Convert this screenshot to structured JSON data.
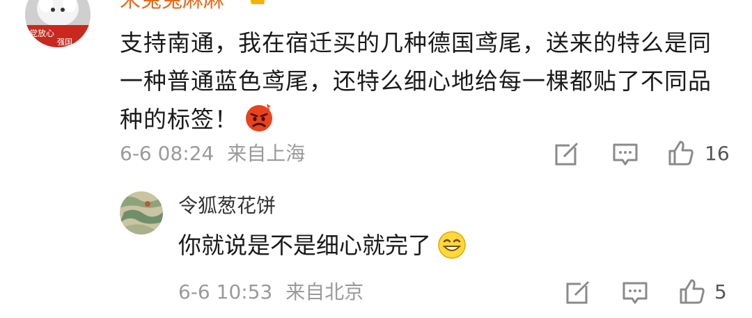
{
  "comment": {
    "username": "宋兔兔麻麻",
    "avatar_caption_1": "党放心",
    "avatar_caption_2": "强国",
    "text": "支持南通，我在宿迁买的几种德国鸢尾，送来的特么是同一种普通蓝色鸢尾，还特么细心地给每一棵都贴了不同品种的标签！",
    "emoji": "angry-face-emoji",
    "date": "6-6 08:24",
    "location": "来自上海",
    "likes": "16"
  },
  "reply": {
    "username": "令狐葱花饼",
    "text": "你就说是不是细心就完了",
    "emoji": "grinning-squint-emoji",
    "date": "6-6 10:53",
    "location": "来自北京",
    "likes": "5"
  },
  "colors": {
    "username_accent": "#e86a18",
    "meta_gray": "#9a9a9a",
    "icon_gray": "#8a8a8a"
  }
}
